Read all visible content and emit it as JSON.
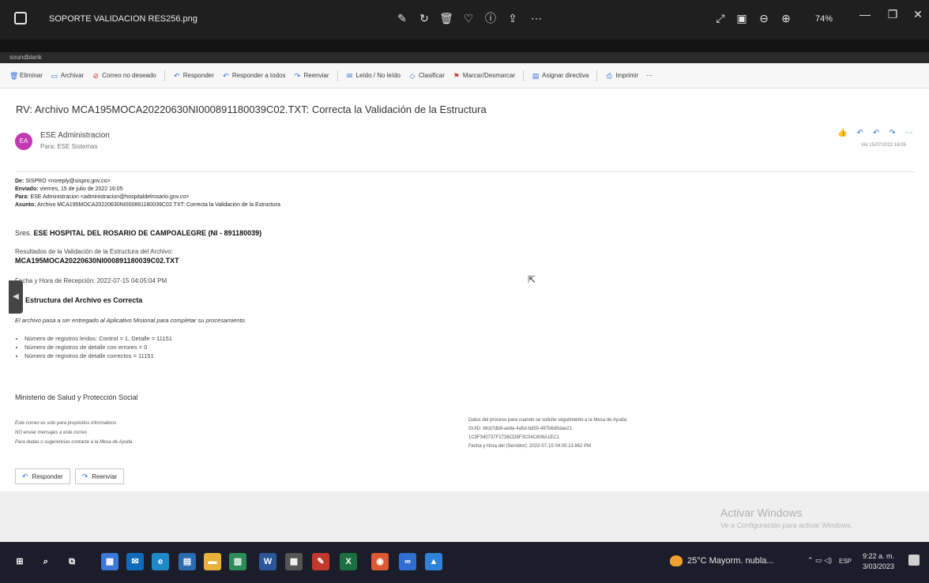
{
  "viewer": {
    "filename": "SOPORTE VALIDACION RES256.png",
    "zoom": "74%",
    "tools": [
      "edit-icon",
      "rotate-icon",
      "delete-icon",
      "heart-icon",
      "info-icon",
      "share-icon",
      "more-icon"
    ],
    "right_tools": [
      "fit-icon",
      "actual-size-icon",
      "zoom-out-icon",
      "zoom-in-icon"
    ]
  },
  "account": {
    "label": "soundblank"
  },
  "commands": [
    {
      "label": "Eliminar",
      "icon": "trash-icon",
      "red": false
    },
    {
      "label": "Archivar",
      "icon": "archive-icon",
      "red": false
    },
    {
      "label": "Correo no deseado",
      "icon": "block-icon",
      "red": true
    },
    {
      "label": "Responder",
      "icon": "reply-icon",
      "red": false
    },
    {
      "label": "Responder a todos",
      "icon": "reply-all-icon",
      "red": false
    },
    {
      "label": "Reenviar",
      "icon": "forward-icon",
      "red": false
    },
    {
      "label": "Leído / No leído",
      "icon": "envelope-icon",
      "red": false
    },
    {
      "label": "Clasificar",
      "icon": "tag-icon",
      "red": false
    },
    {
      "label": "Marcar/Desmarcar",
      "icon": "flag-icon",
      "red": true
    },
    {
      "label": "Asignar directiva",
      "icon": "policy-icon",
      "red": false
    },
    {
      "label": "Imprimir",
      "icon": "print-icon",
      "red": false
    }
  ],
  "email": {
    "subject": "RV: Archivo MCA195MOCA20220630NI000891180039C02.TXT: Correcta la Validación de la Estructura",
    "avatar_initials": "EA",
    "avatar_color": "#c239b3",
    "sender": "ESE Administracion",
    "recipient": "Para: ESE Sistemas",
    "date": "Vie 15/07/2022 16:05",
    "fwd": {
      "de_label": "De:",
      "de_value": "SISPRO <noreply@sispro.gov.co>",
      "enviado_label": "Enviado:",
      "enviado_value": "viernes, 15 de julio de 2022 16:05",
      "para_label": "Para:",
      "para_value": "ESE Administracion <administracion@hospitaldelrosario.gov.co>",
      "asunto_label": "Asunto:",
      "asunto_value": "Archivo MCA195MOCA20220630NI000891180039C02.TXT: Correcta la Validación de la Estructura"
    },
    "srs_prefix": "Sres.",
    "srs_name": "ESE HOSPITAL DEL ROSARIO DE CAMPOALEGRE (NI - 891180039)",
    "results_title": "Resultados de la Validación de la Estructura del Archivo:",
    "results_file": "MCA195MOCA20220630NI000891180039C02.TXT",
    "reception": "Fecha y Hora de Recepción: 2022-07-15 04:05:04 PM",
    "estructura": "Estructura del Archivo es Correcta",
    "note": "El archivo pasa a ser entregado al Aplicativo Misional para completar su procesamiento.",
    "bullets": [
      "Número de registros leídos: Control = 1, Detalle = 11151",
      "Número de registros de detalle con errores = 0",
      "Número de registros de detalle correctos = 11151"
    ],
    "ministerio": "Ministerio de Salud y Protección Social",
    "footnotes": [
      "Este correo es sólo para propósitos informativos",
      "NO enviar mensajes a este correo",
      "Para dudas o sugerencias contacte a la Mesa de Ayuda"
    ],
    "process_info": [
      "Datos del proceso para cuando se solicite seguimiento a la Mesa de Ayuda:",
      "GUID: bfcb7db9-ae8e-4a5d-bd50-497b6d5dae21",
      "1C9F340737F2736CD8F3C04C806A1EC1",
      "Fecha y Hora del (Servidor): 2022-07-15 04:05:13.862 PM"
    ],
    "reply_label": "Responder",
    "forward_label": "Reenviar"
  },
  "watermark": {
    "title": "Activar Windows",
    "subtitle": "Ve a Configuración para activar Windows."
  },
  "taskbar": {
    "icons": [
      {
        "name": "start-icon",
        "glyph": "⊞",
        "color": "#1b1e2a"
      },
      {
        "name": "search-icon",
        "glyph": "⌕",
        "color": "#1b1e2a"
      },
      {
        "name": "task-view-icon",
        "glyph": "⧉",
        "color": "#1b1e2a"
      },
      {
        "name": "calendar-app-icon",
        "glyph": "▦",
        "color": "#3b78d8"
      },
      {
        "name": "mail-app-icon",
        "glyph": "✉",
        "color": "#0f6cbd"
      },
      {
        "name": "edge-icon",
        "glyph": "e",
        "color": "#1e88c8"
      },
      {
        "name": "store-icon",
        "glyph": "▤",
        "color": "#2b6cb0"
      },
      {
        "name": "explorer-icon",
        "glyph": "▬",
        "color": "#e8b23a"
      },
      {
        "name": "spreadsheet-app-icon",
        "glyph": "▥",
        "color": "#2e8b57"
      },
      {
        "name": "word-icon",
        "glyph": "W",
        "color": "#2b579a"
      },
      {
        "name": "calculator-icon",
        "glyph": "▦",
        "color": "#555555"
      },
      {
        "name": "pen-app-icon",
        "glyph": "✎",
        "color": "#c0392b"
      },
      {
        "name": "excel-icon",
        "glyph": "X",
        "color": "#1d6f42"
      },
      {
        "name": "chrome-icon",
        "glyph": "◉",
        "color": "#de5833"
      },
      {
        "name": "teams-icon",
        "glyph": "∞",
        "color": "#2f6fd1"
      },
      {
        "name": "photos-icon",
        "glyph": "▲",
        "color": "#2f82d6"
      }
    ],
    "weather": "25°C  Mayorm. nubla...",
    "lang": "ESP",
    "time": "9:22 a. m.",
    "date": "3/03/2023"
  }
}
